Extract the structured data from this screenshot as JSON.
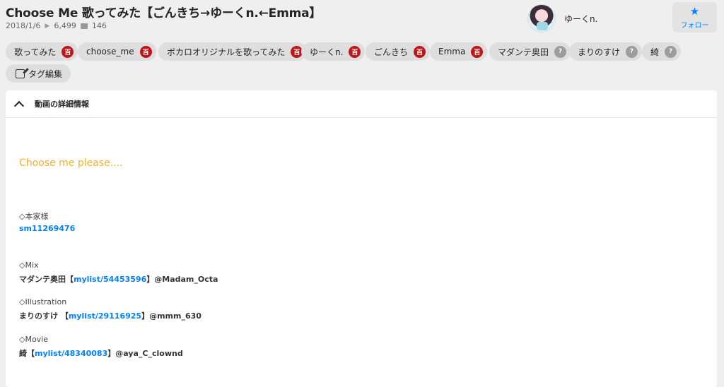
{
  "video": {
    "title": "Choose Me 歌ってみた【ごんきち→ゆーくn.←Emma】",
    "date": "2018/1/6",
    "views": "6,499",
    "comments": "146"
  },
  "owner": {
    "name": "ゆーくn."
  },
  "follow": {
    "label": "フォロー"
  },
  "tags": [
    {
      "label": "歌ってみた",
      "badge": "百"
    },
    {
      "label": "choose_me",
      "badge": "百"
    },
    {
      "label": "ボカロオリジナルを歌ってみた",
      "badge": "百"
    },
    {
      "label": "ゆーくn.",
      "badge": "百"
    },
    {
      "label": "ごんきち",
      "badge": "百"
    },
    {
      "label": "Emma",
      "badge": "百"
    },
    {
      "label": "マダンテ奥田",
      "badge": "?"
    },
    {
      "label": "まりのすけ",
      "badge": "?"
    },
    {
      "label": "綺",
      "badge": "?"
    }
  ],
  "tag_edit": {
    "label": "タグ編集"
  },
  "details": {
    "heading": "動画の詳細情報",
    "tagline": "Choose me please....",
    "original_label": "◇本家様",
    "original_link": "sm11269476",
    "mix_label": "◇Mix",
    "mix_name": "マダンテ奥田【",
    "mix_link": "mylist/54453596",
    "mix_suffix": "】@Madam_Octa",
    "illust_label": "◇Illustration",
    "illust_name": "まりのすけ 【",
    "illust_link": "mylist/29116925",
    "illust_suffix": "】@mmm_630",
    "movie_label": "◇Movie",
    "movie_name": "綺【",
    "movie_link": "mylist/48340083",
    "movie_suffix": "】@aya_C_clownd"
  },
  "colors": {
    "accent": "#0080ff",
    "tag_badge_locked": "#c0161a",
    "tag_badge_unknown": "#9c9c9c",
    "tagline": "#f4b02f"
  }
}
